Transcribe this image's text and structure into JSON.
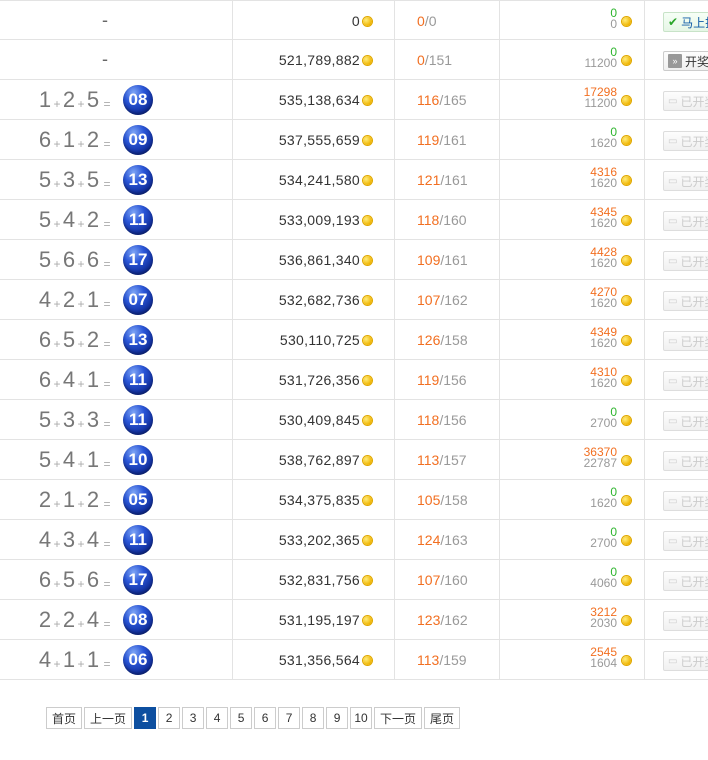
{
  "rows": [
    {
      "type": "pending",
      "formula": "-",
      "amount": "0",
      "ratio_a": "0",
      "ratio_b": "0",
      "win_top": "0",
      "win_bot": "0",
      "button": "马上投注",
      "button_kind": "go"
    },
    {
      "type": "pending",
      "formula": "-",
      "amount": "521,789,882",
      "ratio_a": "0",
      "ratio_b": "151",
      "win_top": "0",
      "win_bot": "11200",
      "button": "开奖",
      "button_kind": "open"
    },
    {
      "type": "done",
      "nums": [
        "1",
        "2",
        "5"
      ],
      "result": "08",
      "amount": "535,138,634",
      "ratio_a": "116",
      "ratio_b": "165",
      "win_top": "17298",
      "win_bot": "11200",
      "button": "已开奖"
    },
    {
      "type": "done",
      "nums": [
        "6",
        "1",
        "2"
      ],
      "result": "09",
      "amount": "537,555,659",
      "ratio_a": "119",
      "ratio_b": "161",
      "win_top": "0",
      "win_bot": "1620",
      "button": "已开奖"
    },
    {
      "type": "done",
      "nums": [
        "5",
        "3",
        "5"
      ],
      "result": "13",
      "amount": "534,241,580",
      "ratio_a": "121",
      "ratio_b": "161",
      "win_top": "4316",
      "win_bot": "1620",
      "button": "已开奖"
    },
    {
      "type": "done",
      "nums": [
        "5",
        "4",
        "2"
      ],
      "result": "11",
      "amount": "533,009,193",
      "ratio_a": "118",
      "ratio_b": "160",
      "win_top": "4345",
      "win_bot": "1620",
      "button": "已开奖"
    },
    {
      "type": "done",
      "nums": [
        "5",
        "6",
        "6"
      ],
      "result": "17",
      "amount": "536,861,340",
      "ratio_a": "109",
      "ratio_b": "161",
      "win_top": "4428",
      "win_bot": "1620",
      "button": "已开奖"
    },
    {
      "type": "done",
      "nums": [
        "4",
        "2",
        "1"
      ],
      "result": "07",
      "amount": "532,682,736",
      "ratio_a": "107",
      "ratio_b": "162",
      "win_top": "4270",
      "win_bot": "1620",
      "button": "已开奖"
    },
    {
      "type": "done",
      "nums": [
        "6",
        "5",
        "2"
      ],
      "result": "13",
      "amount": "530,110,725",
      "ratio_a": "126",
      "ratio_b": "158",
      "win_top": "4349",
      "win_bot": "1620",
      "button": "已开奖"
    },
    {
      "type": "done",
      "nums": [
        "6",
        "4",
        "1"
      ],
      "result": "11",
      "amount": "531,726,356",
      "ratio_a": "119",
      "ratio_b": "156",
      "win_top": "4310",
      "win_bot": "1620",
      "button": "已开奖"
    },
    {
      "type": "done",
      "nums": [
        "5",
        "3",
        "3"
      ],
      "result": "11",
      "amount": "530,409,845",
      "ratio_a": "118",
      "ratio_b": "156",
      "win_top": "0",
      "win_bot": "2700",
      "button": "已开奖"
    },
    {
      "type": "done",
      "nums": [
        "5",
        "4",
        "1"
      ],
      "result": "10",
      "amount": "538,762,897",
      "ratio_a": "113",
      "ratio_b": "157",
      "win_top": "36370",
      "win_bot": "22787",
      "button": "已开奖"
    },
    {
      "type": "done",
      "nums": [
        "2",
        "1",
        "2"
      ],
      "result": "05",
      "amount": "534,375,835",
      "ratio_a": "105",
      "ratio_b": "158",
      "win_top": "0",
      "win_bot": "1620",
      "button": "已开奖"
    },
    {
      "type": "done",
      "nums": [
        "4",
        "3",
        "4"
      ],
      "result": "11",
      "amount": "533,202,365",
      "ratio_a": "124",
      "ratio_b": "163",
      "win_top": "0",
      "win_bot": "2700",
      "button": "已开奖"
    },
    {
      "type": "done",
      "nums": [
        "6",
        "5",
        "6"
      ],
      "result": "17",
      "amount": "532,831,756",
      "ratio_a": "107",
      "ratio_b": "160",
      "win_top": "0",
      "win_bot": "4060",
      "button": "已开奖"
    },
    {
      "type": "done",
      "nums": [
        "2",
        "2",
        "4"
      ],
      "result": "08",
      "amount": "531,195,197",
      "ratio_a": "123",
      "ratio_b": "162",
      "win_top": "3212",
      "win_bot": "2030",
      "button": "已开奖"
    },
    {
      "type": "done",
      "nums": [
        "4",
        "1",
        "1"
      ],
      "result": "06",
      "amount": "531,356,564",
      "ratio_a": "113",
      "ratio_b": "159",
      "win_top": "2545",
      "win_bot": "1604",
      "button": "已开奖"
    }
  ],
  "symbols": {
    "plus": "+",
    "equals": "=",
    "slash": "/"
  },
  "icons": {
    "coin": "gold-coin-icon",
    "check": "check-icon",
    "double_arrow": "double-arrow-icon",
    "lock": "flag-icon"
  },
  "colors": {
    "accent_orange": "#f26f21",
    "win_green": "#2db42d",
    "ball_blue": "#1a3fb8",
    "pager_active": "#0d4fa0"
  },
  "pager": {
    "first": "首页",
    "prev": "上一页",
    "pages": [
      "1",
      "2",
      "3",
      "4",
      "5",
      "6",
      "7",
      "8",
      "9",
      "10"
    ],
    "current": "1",
    "next": "下一页",
    "last": "尾页"
  }
}
